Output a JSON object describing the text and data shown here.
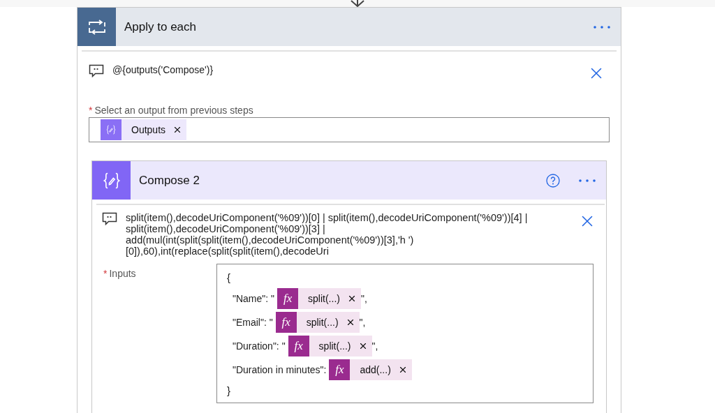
{
  "loop": {
    "title": "Apply to each",
    "comment": "@{outputs('Compose')}",
    "field": {
      "label": "Select an output from previous steps",
      "required_mark": "*",
      "tokens": [
        {
          "kind": "dynamic",
          "label": "Outputs"
        }
      ]
    },
    "action": {
      "title": "Compose 2",
      "comment": "split(item(),decodeUriComponent('%09'))[0] | split(item(),decodeUriComponent('%09'))[4] | split(item(),decodeUriComponent('%09'))[3] | add(mul(int(split(split(item(),decodeUriComponent('%09'))[3],'h ')[0]),60),int(replace(split(split(item(),decodeUri",
      "inputs": {
        "label": "Inputs",
        "required_mark": "*",
        "open": "{",
        "close": "}",
        "lines": [
          {
            "prefix": "\"Name\": \"",
            "token": {
              "kind": "expression",
              "icon": "fx",
              "label": "split(...)"
            },
            "suffix": "\","
          },
          {
            "prefix": "\"Email\": \"",
            "token": {
              "kind": "expression",
              "icon": "fx",
              "label": "split(...)"
            },
            "suffix": "\","
          },
          {
            "prefix": "\"Duration\": \"",
            "token": {
              "kind": "expression",
              "icon": "fx",
              "label": "split(...)"
            },
            "suffix": "\","
          },
          {
            "prefix": "\"Duration in minutes\":",
            "token": {
              "kind": "expression",
              "icon": "fx",
              "label": "add(...)"
            }
          }
        ]
      }
    }
  }
}
